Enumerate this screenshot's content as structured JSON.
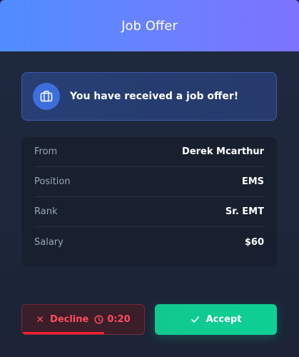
{
  "dialog": {
    "title": "Job Offer"
  },
  "notice": {
    "icon": "briefcase-icon",
    "text": "You have received a job offer!"
  },
  "details": [
    {
      "label": "From",
      "value": "Derek Mcarthur"
    },
    {
      "label": "Position",
      "value": "EMS"
    },
    {
      "label": "Rank",
      "value": "Sr. EMT"
    },
    {
      "label": "Salary",
      "value": "$60"
    }
  ],
  "actions": {
    "decline_label": "Decline",
    "timer": "0:20",
    "timer_progress": 0.67,
    "accept_label": "Accept"
  },
  "colors": {
    "header_start": "#4f8dff",
    "header_end": "#7c72ff",
    "decline": "#ff4d5a",
    "accept": "#10c98f"
  }
}
